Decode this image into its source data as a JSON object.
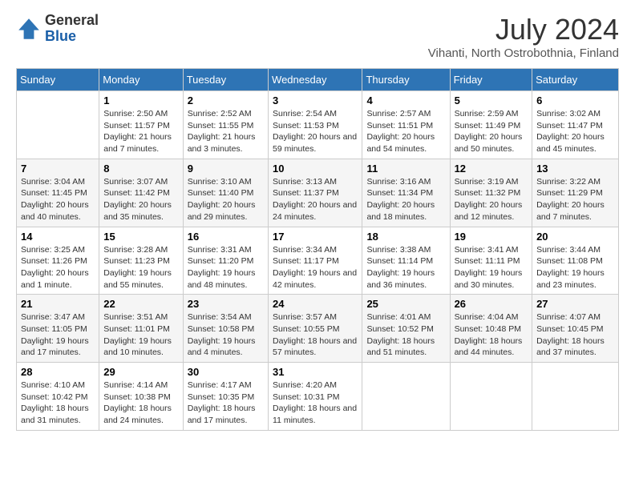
{
  "logo": {
    "general": "General",
    "blue": "Blue"
  },
  "title": "July 2024",
  "location": "Vihanti, North Ostrobothnia, Finland",
  "days_of_week": [
    "Sunday",
    "Monday",
    "Tuesday",
    "Wednesday",
    "Thursday",
    "Friday",
    "Saturday"
  ],
  "weeks": [
    [
      {
        "day": "",
        "sunrise": "",
        "sunset": "",
        "daylight": ""
      },
      {
        "day": "1",
        "sunrise": "Sunrise: 2:50 AM",
        "sunset": "Sunset: 11:57 PM",
        "daylight": "Daylight: 21 hours and 7 minutes."
      },
      {
        "day": "2",
        "sunrise": "Sunrise: 2:52 AM",
        "sunset": "Sunset: 11:55 PM",
        "daylight": "Daylight: 21 hours and 3 minutes."
      },
      {
        "day": "3",
        "sunrise": "Sunrise: 2:54 AM",
        "sunset": "Sunset: 11:53 PM",
        "daylight": "Daylight: 20 hours and 59 minutes."
      },
      {
        "day": "4",
        "sunrise": "Sunrise: 2:57 AM",
        "sunset": "Sunset: 11:51 PM",
        "daylight": "Daylight: 20 hours and 54 minutes."
      },
      {
        "day": "5",
        "sunrise": "Sunrise: 2:59 AM",
        "sunset": "Sunset: 11:49 PM",
        "daylight": "Daylight: 20 hours and 50 minutes."
      },
      {
        "day": "6",
        "sunrise": "Sunrise: 3:02 AM",
        "sunset": "Sunset: 11:47 PM",
        "daylight": "Daylight: 20 hours and 45 minutes."
      }
    ],
    [
      {
        "day": "7",
        "sunrise": "Sunrise: 3:04 AM",
        "sunset": "Sunset: 11:45 PM",
        "daylight": "Daylight: 20 hours and 40 minutes."
      },
      {
        "day": "8",
        "sunrise": "Sunrise: 3:07 AM",
        "sunset": "Sunset: 11:42 PM",
        "daylight": "Daylight: 20 hours and 35 minutes."
      },
      {
        "day": "9",
        "sunrise": "Sunrise: 3:10 AM",
        "sunset": "Sunset: 11:40 PM",
        "daylight": "Daylight: 20 hours and 29 minutes."
      },
      {
        "day": "10",
        "sunrise": "Sunrise: 3:13 AM",
        "sunset": "Sunset: 11:37 PM",
        "daylight": "Daylight: 20 hours and 24 minutes."
      },
      {
        "day": "11",
        "sunrise": "Sunrise: 3:16 AM",
        "sunset": "Sunset: 11:34 PM",
        "daylight": "Daylight: 20 hours and 18 minutes."
      },
      {
        "day": "12",
        "sunrise": "Sunrise: 3:19 AM",
        "sunset": "Sunset: 11:32 PM",
        "daylight": "Daylight: 20 hours and 12 minutes."
      },
      {
        "day": "13",
        "sunrise": "Sunrise: 3:22 AM",
        "sunset": "Sunset: 11:29 PM",
        "daylight": "Daylight: 20 hours and 7 minutes."
      }
    ],
    [
      {
        "day": "14",
        "sunrise": "Sunrise: 3:25 AM",
        "sunset": "Sunset: 11:26 PM",
        "daylight": "Daylight: 20 hours and 1 minute."
      },
      {
        "day": "15",
        "sunrise": "Sunrise: 3:28 AM",
        "sunset": "Sunset: 11:23 PM",
        "daylight": "Daylight: 19 hours and 55 minutes."
      },
      {
        "day": "16",
        "sunrise": "Sunrise: 3:31 AM",
        "sunset": "Sunset: 11:20 PM",
        "daylight": "Daylight: 19 hours and 48 minutes."
      },
      {
        "day": "17",
        "sunrise": "Sunrise: 3:34 AM",
        "sunset": "Sunset: 11:17 PM",
        "daylight": "Daylight: 19 hours and 42 minutes."
      },
      {
        "day": "18",
        "sunrise": "Sunrise: 3:38 AM",
        "sunset": "Sunset: 11:14 PM",
        "daylight": "Daylight: 19 hours and 36 minutes."
      },
      {
        "day": "19",
        "sunrise": "Sunrise: 3:41 AM",
        "sunset": "Sunset: 11:11 PM",
        "daylight": "Daylight: 19 hours and 30 minutes."
      },
      {
        "day": "20",
        "sunrise": "Sunrise: 3:44 AM",
        "sunset": "Sunset: 11:08 PM",
        "daylight": "Daylight: 19 hours and 23 minutes."
      }
    ],
    [
      {
        "day": "21",
        "sunrise": "Sunrise: 3:47 AM",
        "sunset": "Sunset: 11:05 PM",
        "daylight": "Daylight: 19 hours and 17 minutes."
      },
      {
        "day": "22",
        "sunrise": "Sunrise: 3:51 AM",
        "sunset": "Sunset: 11:01 PM",
        "daylight": "Daylight: 19 hours and 10 minutes."
      },
      {
        "day": "23",
        "sunrise": "Sunrise: 3:54 AM",
        "sunset": "Sunset: 10:58 PM",
        "daylight": "Daylight: 19 hours and 4 minutes."
      },
      {
        "day": "24",
        "sunrise": "Sunrise: 3:57 AM",
        "sunset": "Sunset: 10:55 PM",
        "daylight": "Daylight: 18 hours and 57 minutes."
      },
      {
        "day": "25",
        "sunrise": "Sunrise: 4:01 AM",
        "sunset": "Sunset: 10:52 PM",
        "daylight": "Daylight: 18 hours and 51 minutes."
      },
      {
        "day": "26",
        "sunrise": "Sunrise: 4:04 AM",
        "sunset": "Sunset: 10:48 PM",
        "daylight": "Daylight: 18 hours and 44 minutes."
      },
      {
        "day": "27",
        "sunrise": "Sunrise: 4:07 AM",
        "sunset": "Sunset: 10:45 PM",
        "daylight": "Daylight: 18 hours and 37 minutes."
      }
    ],
    [
      {
        "day": "28",
        "sunrise": "Sunrise: 4:10 AM",
        "sunset": "Sunset: 10:42 PM",
        "daylight": "Daylight: 18 hours and 31 minutes."
      },
      {
        "day": "29",
        "sunrise": "Sunrise: 4:14 AM",
        "sunset": "Sunset: 10:38 PM",
        "daylight": "Daylight: 18 hours and 24 minutes."
      },
      {
        "day": "30",
        "sunrise": "Sunrise: 4:17 AM",
        "sunset": "Sunset: 10:35 PM",
        "daylight": "Daylight: 18 hours and 17 minutes."
      },
      {
        "day": "31",
        "sunrise": "Sunrise: 4:20 AM",
        "sunset": "Sunset: 10:31 PM",
        "daylight": "Daylight: 18 hours and 11 minutes."
      },
      {
        "day": "",
        "sunrise": "",
        "sunset": "",
        "daylight": ""
      },
      {
        "day": "",
        "sunrise": "",
        "sunset": "",
        "daylight": ""
      },
      {
        "day": "",
        "sunrise": "",
        "sunset": "",
        "daylight": ""
      }
    ]
  ]
}
